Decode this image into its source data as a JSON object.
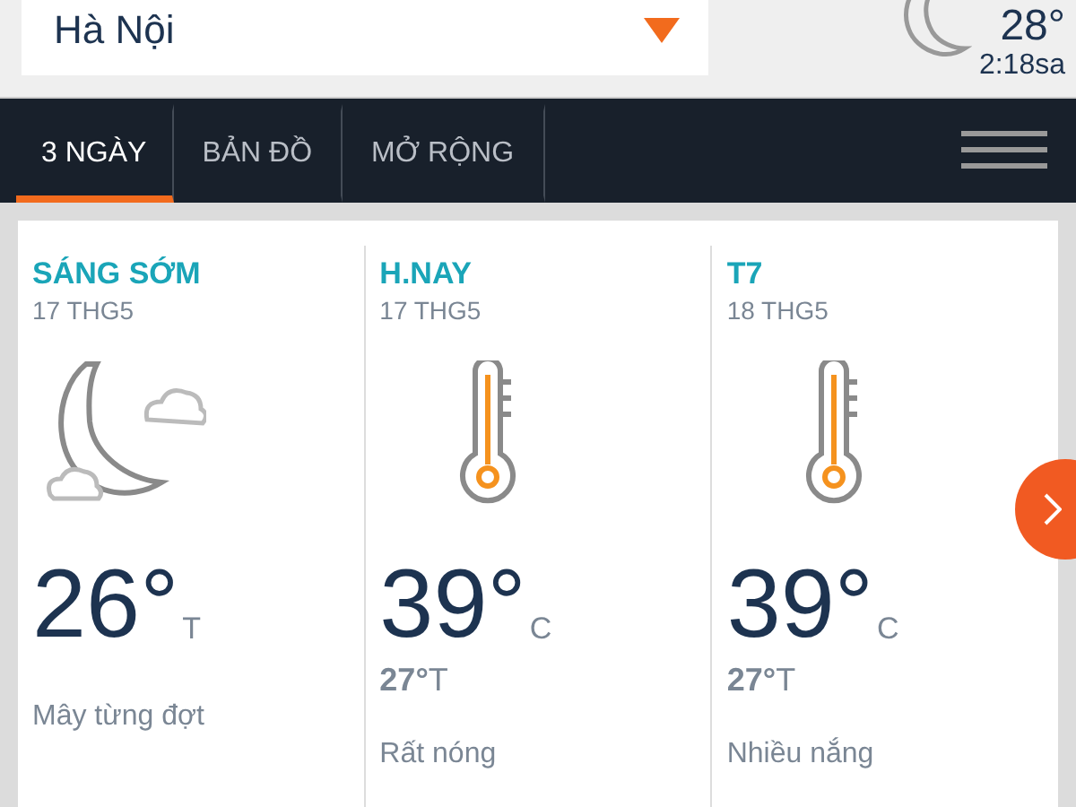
{
  "location": {
    "value": "Hà Nội"
  },
  "current": {
    "temp": "28°",
    "time": "2:18sa"
  },
  "tabs": [
    {
      "label": "3 NGÀY",
      "selected": true
    },
    {
      "label": "BẢN ĐỒ",
      "selected": false
    },
    {
      "label": "MỞ RỘNG",
      "selected": false
    }
  ],
  "days": [
    {
      "title": "SÁNG SỚM",
      "date": "17 THG5",
      "kind": "night",
      "temp": "26°",
      "unit": "T",
      "desc": "Mây từng đợt"
    },
    {
      "title": "H.NAY",
      "date": "17 THG5",
      "kind": "hot",
      "temp": "39°",
      "unit": "C",
      "low": "**27°**T",
      "desc": "Rất nóng"
    },
    {
      "title": "T7",
      "date": "18 THG5",
      "kind": "hot",
      "temp": "39°",
      "unit": "C",
      "low": "**27°**T",
      "desc": "Nhiều nắng"
    }
  ]
}
